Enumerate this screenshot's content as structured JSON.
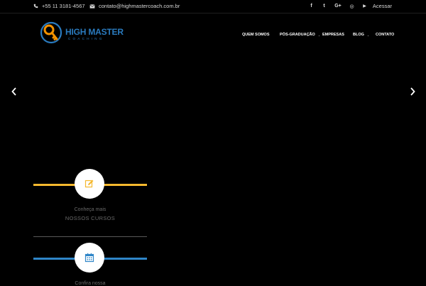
{
  "topbar": {
    "phone": "+55 11 3181-4567",
    "email": "contato@highmastercoach.com.br",
    "social_icons": [
      "facebook-icon",
      "twitter-icon",
      "google-plus-icon",
      "instagram-icon",
      "youtube-icon"
    ],
    "social_glyphs": [
      "f",
      "t",
      "G+",
      "◎",
      "▶"
    ],
    "login": "Acessar"
  },
  "logo": {
    "title": "HIGH MASTER",
    "subtitle": "COACHING",
    "colors": {
      "key": "#f39200",
      "ring": "#2a7bbf"
    }
  },
  "nav": {
    "items": [
      {
        "label": "QUEM SOMOS",
        "has_dropdown": false
      },
      {
        "label": "PÓS-GRADUAÇÃO",
        "has_dropdown": true
      },
      {
        "label": "EMPRESAS",
        "has_dropdown": false
      },
      {
        "label": "BLOG",
        "has_dropdown": true
      },
      {
        "label": "CONTATO",
        "has_dropdown": false
      }
    ]
  },
  "slider": {
    "prev_icon": "chevron-left-icon",
    "next_icon": "chevron-right-icon"
  },
  "features": [
    {
      "icon": "edit-icon",
      "accent": "#f5b82e",
      "subtitle": "Conheça mais",
      "title": "NOSSOS CURSOS"
    },
    {
      "icon": "calendar-icon",
      "accent": "#2f86c8",
      "subtitle": "Confira nossa",
      "title": ""
    }
  ],
  "colors": {
    "background": "#000000",
    "text_muted": "#6a6a6a",
    "accent_yellow": "#f5b82e",
    "accent_blue": "#2f86c8"
  }
}
